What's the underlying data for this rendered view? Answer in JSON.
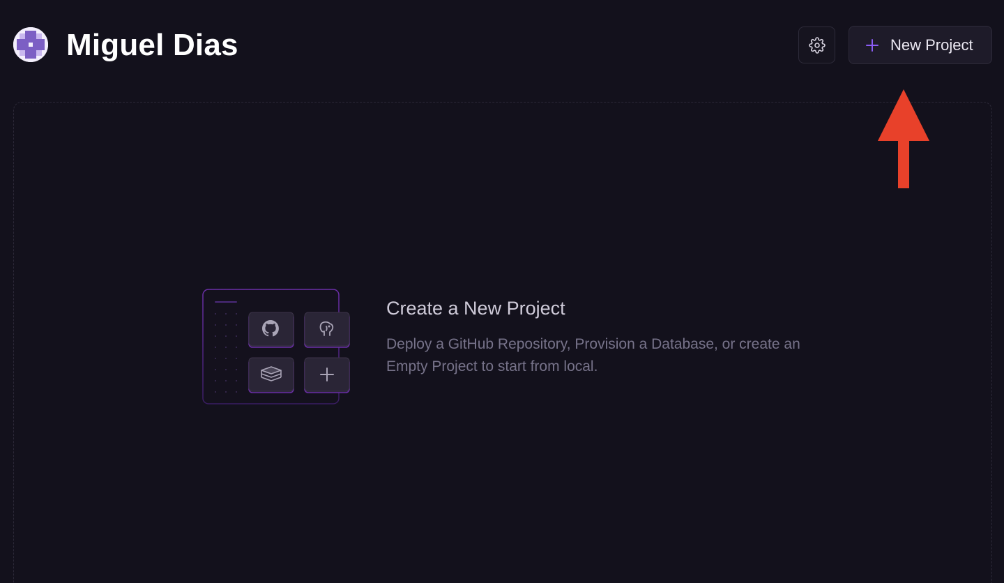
{
  "header": {
    "title": "Miguel Dias",
    "settings_icon": "gear-icon",
    "new_project_label": "New Project",
    "new_project_icon": "plus-icon"
  },
  "empty_state": {
    "title": "Create a New Project",
    "description": "Deploy a GitHub Repository, Provision a Database, or create an Empty Project to start from local.",
    "illustration_icons": [
      "github-icon",
      "postgres-elephant-icon",
      "redis-stack-icon",
      "plus-icon"
    ]
  },
  "colors": {
    "background": "#13111c",
    "accent_purple": "#8b5cf6",
    "annotation_red": "#e8412a"
  }
}
